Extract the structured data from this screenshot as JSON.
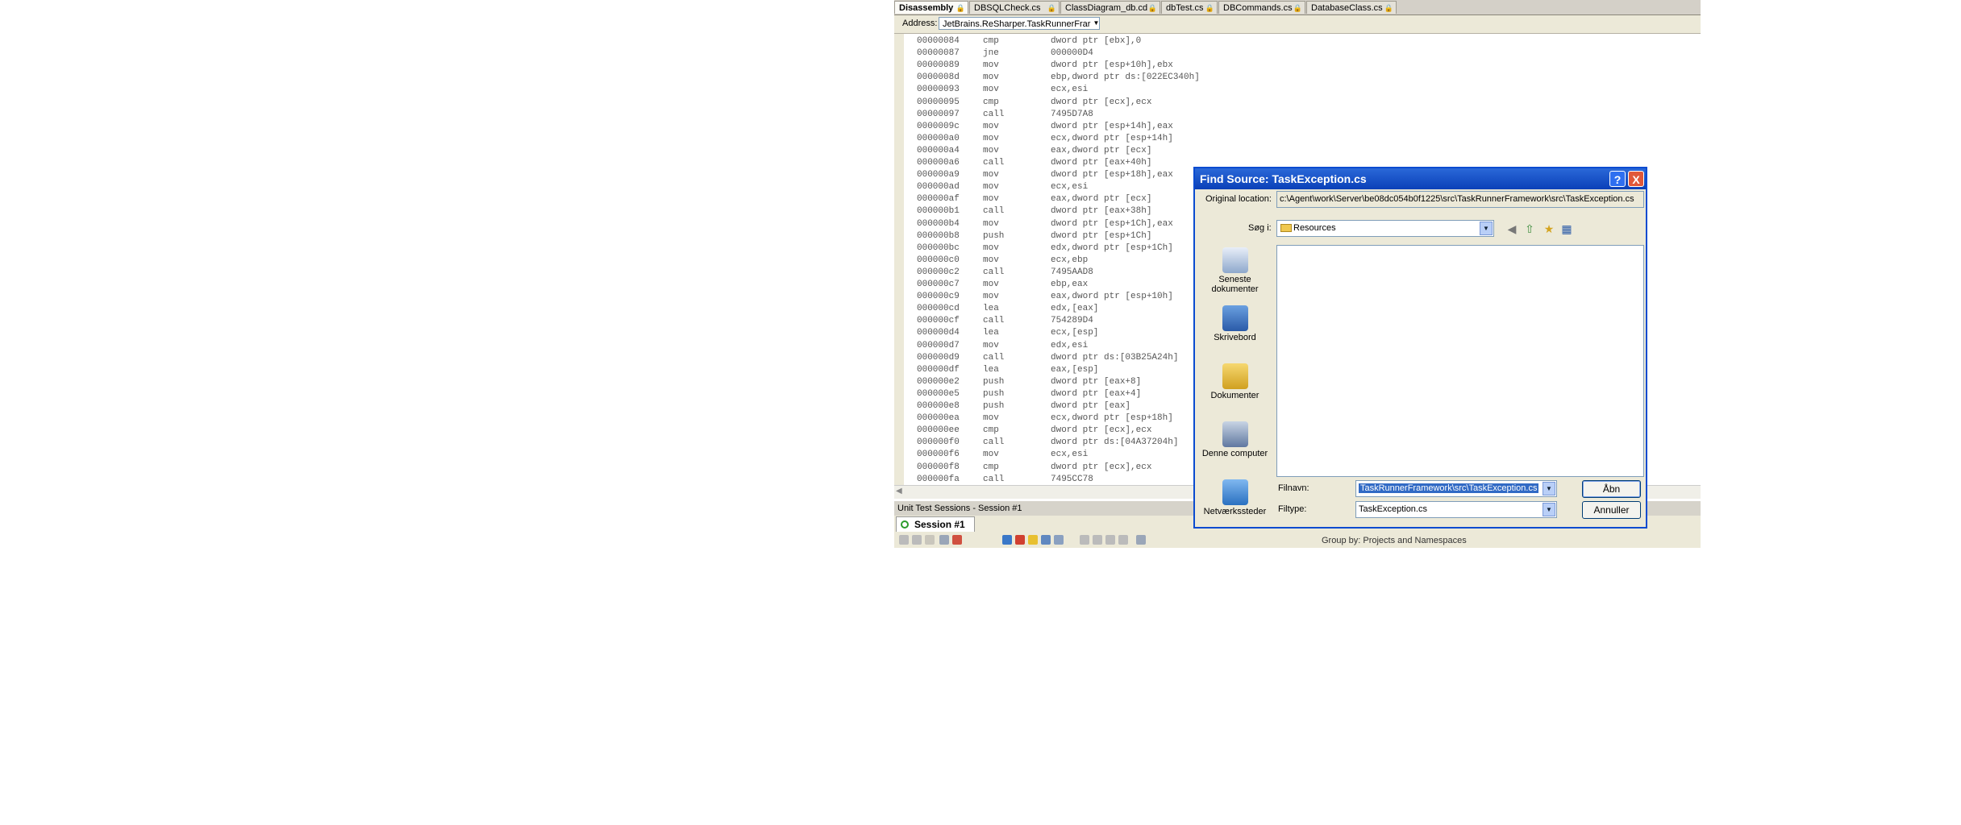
{
  "ide": {
    "tabs": [
      {
        "label": "Disassembly",
        "lock": "lock-icon"
      },
      {
        "label": "DBSQLCheck.cs",
        "lock": "lock-icon"
      },
      {
        "label": "ClassDiagram_db.cd",
        "lock": "lock-icon"
      },
      {
        "label": "dbTest.cs",
        "lock": "lock-icon"
      },
      {
        "label": "DBCommands.cs",
        "lock": "lock-icon"
      },
      {
        "label": "DatabaseClass.cs",
        "lock": "lock-icon"
      }
    ],
    "address_label": "Address:",
    "address_value": "JetBrains.ReSharper.TaskRunnerFrar",
    "disassembly": [
      {
        "addr": "00000084",
        "op": "cmp",
        "arg": "dword ptr [ebx],0"
      },
      {
        "addr": "00000087",
        "op": "jne",
        "arg": "000000D4"
      },
      {
        "addr": "00000089",
        "op": "mov",
        "arg": "dword ptr [esp+10h],ebx"
      },
      {
        "addr": "0000008d",
        "op": "mov",
        "arg": "ebp,dword ptr ds:[022EC340h]"
      },
      {
        "addr": "00000093",
        "op": "mov",
        "arg": "ecx,esi"
      },
      {
        "addr": "00000095",
        "op": "cmp",
        "arg": "dword ptr [ecx],ecx"
      },
      {
        "addr": "00000097",
        "op": "call",
        "arg": "7495D7A8"
      },
      {
        "addr": "0000009c",
        "op": "mov",
        "arg": "dword ptr [esp+14h],eax"
      },
      {
        "addr": "000000a0",
        "op": "mov",
        "arg": "ecx,dword ptr [esp+14h]"
      },
      {
        "addr": "000000a4",
        "op": "mov",
        "arg": "eax,dword ptr [ecx]"
      },
      {
        "addr": "000000a6",
        "op": "call",
        "arg": "dword ptr [eax+40h]"
      },
      {
        "addr": "000000a9",
        "op": "mov",
        "arg": "dword ptr [esp+18h],eax"
      },
      {
        "addr": "000000ad",
        "op": "mov",
        "arg": "ecx,esi"
      },
      {
        "addr": "000000af",
        "op": "mov",
        "arg": "eax,dword ptr [ecx]"
      },
      {
        "addr": "000000b1",
        "op": "call",
        "arg": "dword ptr [eax+38h]"
      },
      {
        "addr": "000000b4",
        "op": "mov",
        "arg": "dword ptr [esp+1Ch],eax"
      },
      {
        "addr": "000000b8",
        "op": "push",
        "arg": "dword ptr [esp+1Ch]"
      },
      {
        "addr": "000000bc",
        "op": "mov",
        "arg": "edx,dword ptr [esp+1Ch]"
      },
      {
        "addr": "000000c0",
        "op": "mov",
        "arg": "ecx,ebp"
      },
      {
        "addr": "000000c2",
        "op": "call",
        "arg": "7495AAD8"
      },
      {
        "addr": "000000c7",
        "op": "mov",
        "arg": "ebp,eax"
      },
      {
        "addr": "000000c9",
        "op": "mov",
        "arg": "eax,dword ptr [esp+10h]"
      },
      {
        "addr": "000000cd",
        "op": "lea",
        "arg": "edx,[eax]"
      },
      {
        "addr": "000000cf",
        "op": "call",
        "arg": "754289D4"
      },
      {
        "addr": "000000d4",
        "op": "lea",
        "arg": "ecx,[esp]"
      },
      {
        "addr": "000000d7",
        "op": "mov",
        "arg": "edx,esi"
      },
      {
        "addr": "000000d9",
        "op": "call",
        "arg": "dword ptr ds:[03B25A24h]"
      },
      {
        "addr": "000000df",
        "op": "lea",
        "arg": "eax,[esp]"
      },
      {
        "addr": "000000e2",
        "op": "push",
        "arg": "dword ptr [eax+8]"
      },
      {
        "addr": "000000e5",
        "op": "push",
        "arg": "dword ptr [eax+4]"
      },
      {
        "addr": "000000e8",
        "op": "push",
        "arg": "dword ptr [eax]"
      },
      {
        "addr": "000000ea",
        "op": "mov",
        "arg": "ecx,dword ptr [esp+18h]"
      },
      {
        "addr": "000000ee",
        "op": "cmp",
        "arg": "dword ptr [ecx],ecx"
      },
      {
        "addr": "000000f0",
        "op": "call",
        "arg": "dword ptr ds:[04A37204h]"
      },
      {
        "addr": "000000f6",
        "op": "mov",
        "arg": "ecx,esi"
      },
      {
        "addr": "000000f8",
        "op": "cmp",
        "arg": "dword ptr [ecx],ecx"
      },
      {
        "addr": "000000fa",
        "op": "call",
        "arg": "7495CC78"
      }
    ],
    "panel_title": "Unit Test Sessions - Session #1",
    "session_tab": "Session #1",
    "group_by": "Group by: Projects and Namespaces"
  },
  "dialog": {
    "title": "Find Source: TaskException.cs",
    "help_label": "?",
    "close_label": "X",
    "original_location_label": "Original location:",
    "original_location_value": "c:\\Agent\\work\\Server\\be08dc054b0f1225\\src\\TaskRunnerFramework\\src\\TaskException.cs",
    "look_in_label": "Søg i:",
    "look_in_value": "Resources",
    "places": [
      {
        "label": "Seneste dokumenter",
        "icon": "recent-documents-icon"
      },
      {
        "label": "Skrivebord",
        "icon": "desktop-icon"
      },
      {
        "label": "Dokumenter",
        "icon": "documents-folder-icon"
      },
      {
        "label": "Denne computer",
        "icon": "my-computer-icon"
      },
      {
        "label": "Netværkssteder",
        "icon": "network-places-icon"
      }
    ],
    "filename_label": "Filnavn:",
    "filename_value": "TaskRunnerFramework\\src\\TaskException.cs",
    "filetype_label": "Filtype:",
    "filetype_value": "TaskException.cs",
    "open_label": "Åbn",
    "cancel_label": "Annuller"
  }
}
